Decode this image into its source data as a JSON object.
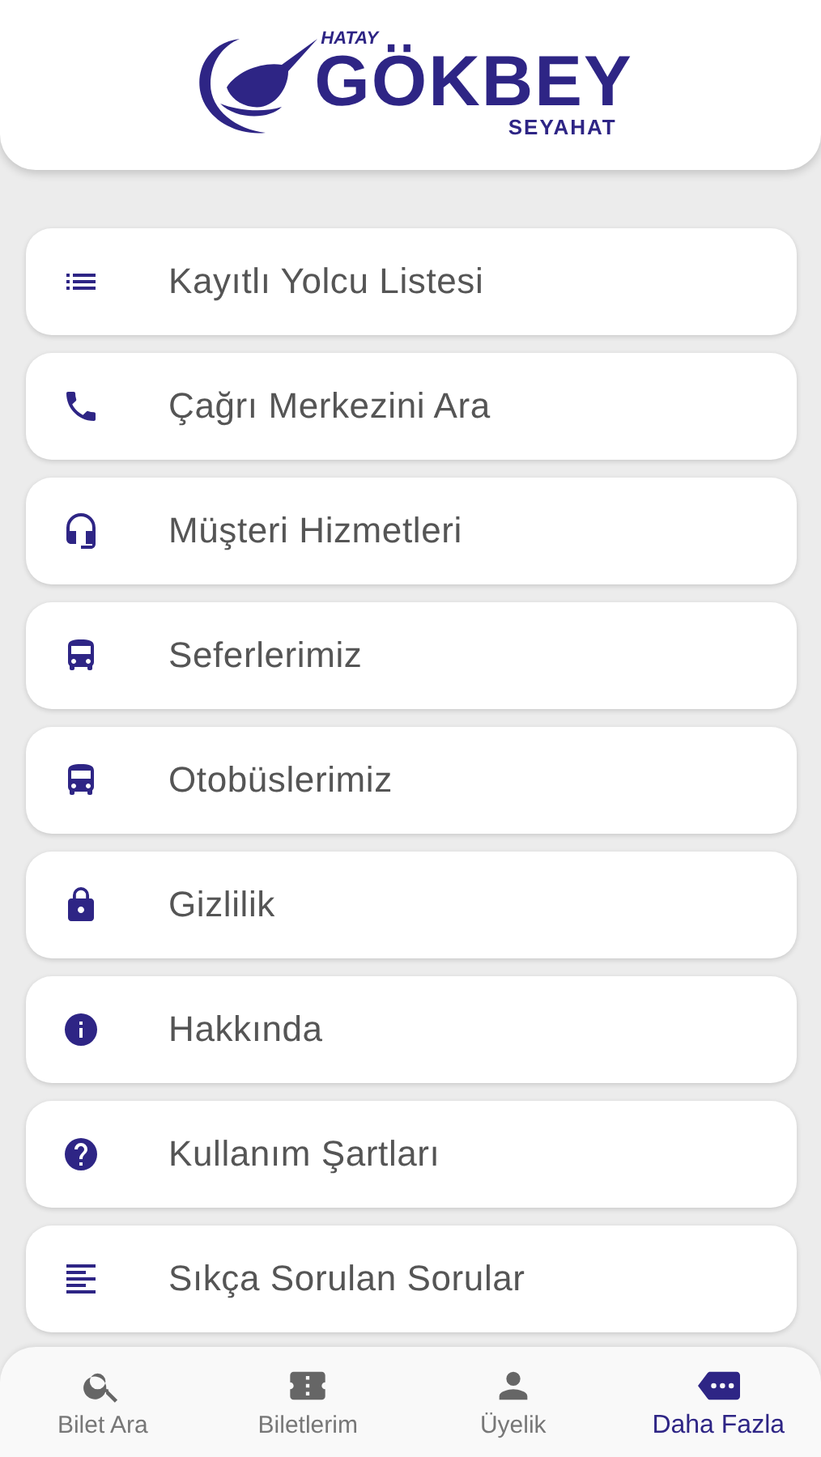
{
  "logo": {
    "top": "HATAY",
    "main": "GÖKBEY",
    "sub": "SEYAHAT"
  },
  "menu": [
    {
      "label": "Kayıtlı Yolcu Listesi"
    },
    {
      "label": "Çağrı Merkezini Ara"
    },
    {
      "label": "Müşteri Hizmetleri"
    },
    {
      "label": "Seferlerimiz"
    },
    {
      "label": "Otobüslerimiz"
    },
    {
      "label": "Gizlilik"
    },
    {
      "label": "Hakkında"
    },
    {
      "label": "Kullanım Şartları"
    },
    {
      "label": "Sıkça Sorulan Sorular"
    }
  ],
  "tabs": [
    {
      "label": "Bilet Ara",
      "selected": false
    },
    {
      "label": "Biletlerim",
      "selected": false
    },
    {
      "label": "Üyelik",
      "selected": false
    },
    {
      "label": "Daha Fazla",
      "selected": true
    }
  ]
}
